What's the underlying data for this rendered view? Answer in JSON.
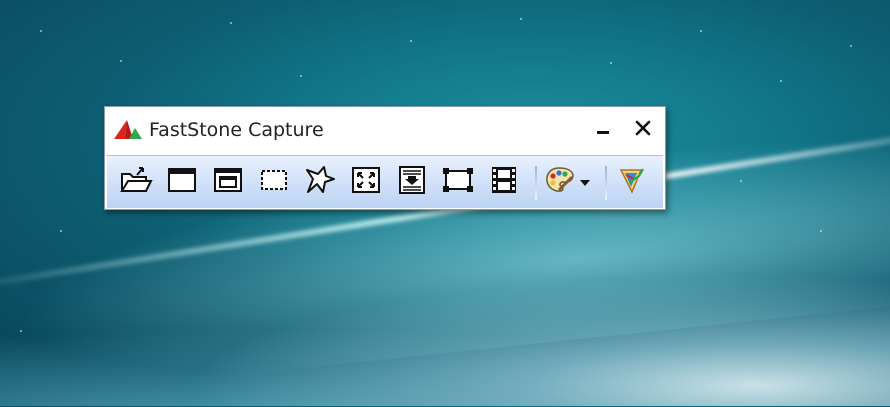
{
  "window": {
    "title": "FastStone Capture"
  },
  "titlebar_controls": {
    "minimize_icon": "minimize-icon",
    "close_icon": "close-icon"
  },
  "toolbar": {
    "tools": [
      {
        "icon": "open-folder-icon"
      },
      {
        "icon": "capture-active-window-icon"
      },
      {
        "icon": "capture-window-object-icon"
      },
      {
        "icon": "capture-rectangle-icon"
      },
      {
        "icon": "capture-freehand-icon"
      },
      {
        "icon": "capture-fullscreen-icon"
      },
      {
        "icon": "capture-scrolling-icon"
      },
      {
        "icon": "capture-fixed-region-icon"
      },
      {
        "icon": "screen-recorder-icon"
      },
      {
        "icon": "output-editor-palette-icon"
      },
      {
        "icon": "dropdown-arrow-icon"
      },
      {
        "icon": "settings-icon"
      }
    ]
  },
  "colors": {
    "logo_red": "#d8261f",
    "logo_green": "#2ea84a",
    "toolbar_top": "#e9f1fd",
    "toolbar_bottom": "#bcd3f3",
    "window_border": "#8a9bb3"
  }
}
